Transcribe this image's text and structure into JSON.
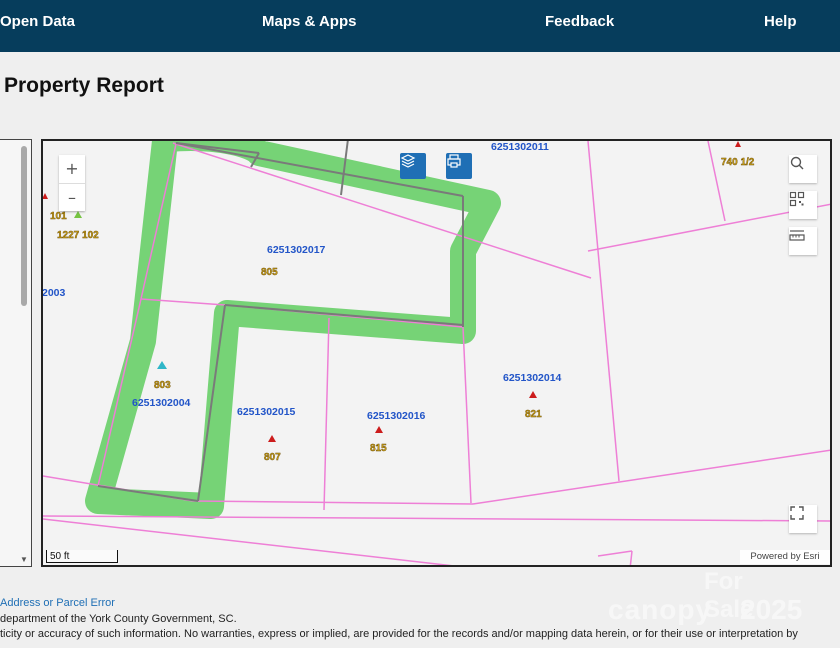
{
  "nav": {
    "items": [
      "Open Data",
      "Maps & Apps",
      "Feedback",
      "Help"
    ]
  },
  "page": {
    "title": "Property Report"
  },
  "map": {
    "zoom_in": "+",
    "zoom_out": "–",
    "parcels": [
      {
        "id": "6251302011",
        "address": ""
      },
      {
        "id": "6251302017",
        "address": "805"
      },
      {
        "id": "6251302004",
        "address": "803"
      },
      {
        "id": "6251302015",
        "address": "807"
      },
      {
        "id": "6251302016",
        "address": "815"
      },
      {
        "id": "6251302014",
        "address": "821"
      },
      {
        "id": "2003",
        "address": ""
      }
    ],
    "other_labels": [
      "101",
      "1227 102",
      "740 1/2"
    ],
    "scale_label": "50 ft",
    "attribution": "Powered by Esri",
    "icons": {
      "layers": "layers-icon",
      "print": "print-icon",
      "search": "search-icon",
      "qr": "qr-code-icon",
      "measure": "measure-icon",
      "fullscreen": "fullscreen-icon"
    },
    "colors": {
      "parcel_line": "#ee7fd6",
      "highlight": "#5fcd5f",
      "label_blue": "#2255c8",
      "label_gold": "#c9a21c",
      "marker_red": "#cc1c1c"
    }
  },
  "footer": {
    "link": "Address or Parcel Error",
    "line1": "department of the York County Government, SC.",
    "line2": "ticity or accuracy of such information. No warranties, express or implied, are provided for the records and/or mapping data herein, or for their use or interpretation by"
  },
  "watermark": {
    "line1": "For Sale",
    "brand": "canopy",
    "year": "2025"
  }
}
